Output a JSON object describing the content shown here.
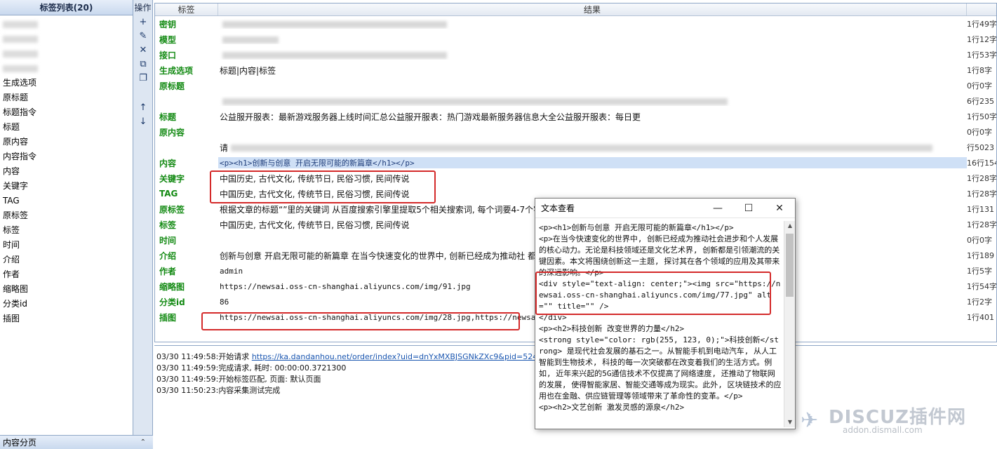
{
  "left_panel": {
    "title": "标签列表(20)",
    "items": [
      "",
      "",
      "",
      "",
      "生成选项",
      "原标题",
      "标题指令",
      "标题",
      "原内容",
      "内容指令",
      "内容",
      "关键字",
      "TAG",
      "原标签",
      "标签",
      "时间",
      "介绍",
      "作者",
      "缩略图",
      "分类id",
      "插图"
    ],
    "footer": "内容分页",
    "footer_icon": "chevron-up-double-icon"
  },
  "ops": {
    "title": "操作",
    "buttons": [
      {
        "icon": "add-icon",
        "glyph": "+"
      },
      {
        "icon": "edit-icon",
        "glyph": "✎"
      },
      {
        "icon": "delete-icon",
        "glyph": "✕"
      },
      {
        "icon": "copy-icon",
        "glyph": "⧉"
      },
      {
        "icon": "paste-icon",
        "glyph": "❐"
      },
      {
        "icon": "move-up-icon",
        "glyph": "↑"
      },
      {
        "icon": "move-down-icon",
        "glyph": "↓"
      }
    ]
  },
  "table": {
    "headers": {
      "tag": "标签",
      "result": "结果",
      "length": ""
    },
    "rows": [
      {
        "tag": "密钥",
        "result": "",
        "len": "1行49字",
        "blur": 320
      },
      {
        "tag": "模型",
        "result": "",
        "len": "1行12字",
        "blur": 80
      },
      {
        "tag": "接口",
        "result": "",
        "len": "1行53字",
        "blur": 320
      },
      {
        "tag": "生成选项",
        "result": "标题|内容|标签",
        "len": "1行8字"
      },
      {
        "tag": "原标题",
        "result": "",
        "len": "0行0字"
      },
      {
        "tag": "",
        "result": "",
        "len": "6行235",
        "blur": 720
      },
      {
        "tag": "标题",
        "result": "公益服开服表：最新游戏服务器上线时间汇总公益服开服表：热门游戏最新服务器信息大全公益服开服表：每日更",
        "len": "1行50字"
      },
      {
        "tag": "原内容",
        "result": "",
        "len": "0行0字"
      },
      {
        "tag": "",
        "result": "请",
        "len": "行5023",
        "blur": 1000
      },
      {
        "tag": "内容",
        "result": "<p><h1>创新与创意 开启无限可能的新篇章</h1></p>",
        "len": "16行154",
        "selected": true
      },
      {
        "tag": "关键字",
        "result": "中国历史, 古代文化, 传统节日, 民俗习惯, 民间传说",
        "len": "1行28字"
      },
      {
        "tag": "TAG",
        "result": "中国历史, 古代文化, 传统节日, 民俗习惯, 民间传说",
        "len": "1行28字"
      },
      {
        "tag": "原标签",
        "result": "根据文章的标题“”里的关键词 从百度搜索引擎里提取5个相关搜索词, 每个词要4-7个字,                                                                  英文逗号隔开, 不要序号, 不要空格。只要...",
        "len": "1行131"
      },
      {
        "tag": "标签",
        "result": "中国历史, 古代文化, 传统节日, 民俗习惯, 民间传说",
        "len": "1行28字"
      },
      {
        "tag": "时间",
        "result": "",
        "len": "0行0字"
      },
      {
        "tag": "介绍",
        "result": "创新与创意 开启无限可能的新篇章 在当今快速变化的世界中, 创新已经成为推动社                                                             都是引领潮流的关键因素。本文将围绕创新...",
        "len": "1行189"
      },
      {
        "tag": "作者",
        "result": "admin",
        "len": "1行5字",
        "mono": true
      },
      {
        "tag": "缩略图",
        "result": "https://newsai.oss-cn-shanghai.aliyuncs.com/img/91.jpg",
        "len": "1行54字",
        "mono": true
      },
      {
        "tag": "分类id",
        "result": "86",
        "len": "1行2字",
        "mono": true
      },
      {
        "tag": "插图",
        "result": "https://newsai.oss-cn-shanghai.aliyuncs.com/img/28.jpg,https://newsai.oss-c                                                    hai.aliyuncs.com/img/30.jpg,https://n...",
        "len": "1行401",
        "mono": true
      }
    ]
  },
  "log": {
    "lines": [
      {
        "time": "03/30 11:49:58:",
        "text": "开始请求 ",
        "link": "https://ka.dandanhou.net/order/index?uid=dnYxMXBJSGNkZXc9&pid=524"
      },
      {
        "time": "03/30 11:49:59:",
        "text": "完成请求, 耗时: 00:00:00.3721300",
        "link": ""
      },
      {
        "time": "03/30 11:49:59:",
        "text": "开始标签匹配, 页面: 默认页面",
        "link": ""
      },
      {
        "time": "03/30 11:50:23:",
        "text": "内容采集测试完成",
        "link": ""
      }
    ]
  },
  "dialog": {
    "title": "文本查看",
    "minimize": "—",
    "maximize": "☐",
    "close": "✕",
    "body": "<p><h1>创新与创意 开启无限可能的新篇章</h1></p>\n<p>在当今快速变化的世界中, 创新已经成为推动社会进步和个人发展的核心动力。无论是科技领域还是文化艺术界, 创新都是引领潮流的关键因素。本文将围绕创新这一主题, 探讨其在各个领域的应用及其带来的深远影响。</p>\n<div style=\"text-align: center;\"><img src=\"https://newsai.oss-cn-shanghai.aliyuncs.com/img/77.jpg\" alt=\"\" title=\"\" />\n</div>\n<p><h2>科技创新 改变世界的力量</h2>\n<strong style=\"color: rgb(255, 123, 0);\">科技创新</strong> 是现代社会发展的基石之一。从智能手机到电动汽车, 从人工智能到生物技术, 科技的每一次突破都在改变着我们的生活方式。例如, 近年来兴起的5G通信技术不仅提高了网络速度, 还推动了物联网的发展, 使得智能家居、智能交通等成为现实。此外, 区块链技术的应用也在金融、供应链管理等领域带来了革命性的变革。</p>\n<p><h2>文艺创新 激发灵感的源泉</h2>"
  },
  "watermark": {
    "main": "DISCUZ插件网",
    "sub": "addon.dismall.com"
  },
  "colors": {
    "tag_green": "#138a13",
    "highlight_red": "#d42a2a",
    "selected_row": "#cfe0f6",
    "panel_border": "#8fa7c6"
  }
}
